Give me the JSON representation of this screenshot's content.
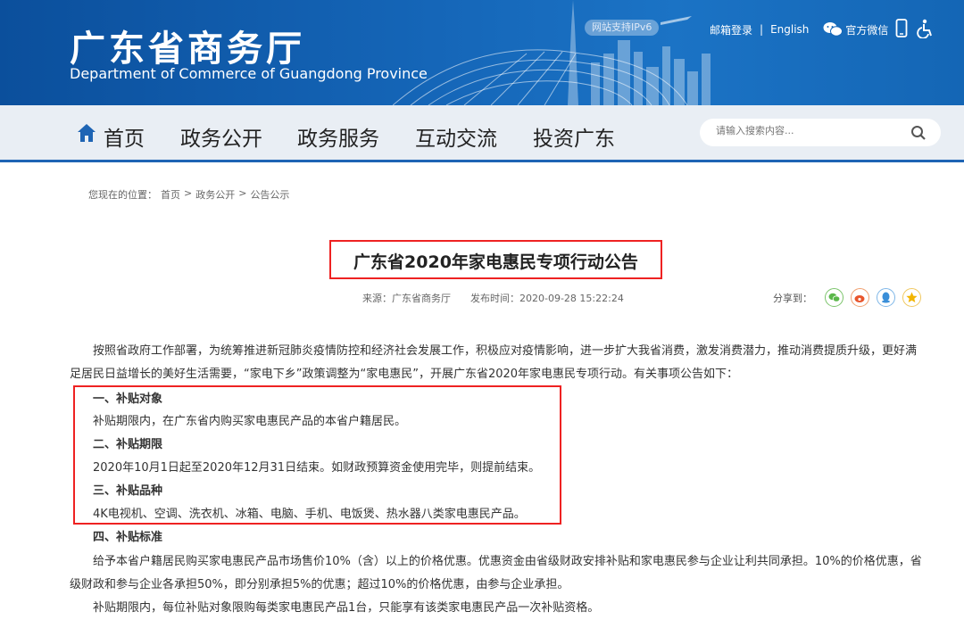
{
  "header": {
    "title_cn": "广东省商务厅",
    "title_en": "Department of Commerce of Guangdong Province",
    "ipv6_badge": "网站支持IPv6",
    "mail_login": "邮箱登录",
    "separator": "|",
    "english": "English",
    "wechat": "官方微信"
  },
  "nav": {
    "items": [
      "首页",
      "政务公开",
      "政务服务",
      "互动交流",
      "投资广东"
    ],
    "search_placeholder": "请输入搜索内容..."
  },
  "breadcrumb": {
    "prefix": "您现在的位置：",
    "items": [
      "首页",
      "政务公开",
      "公告公示"
    ],
    "sep": ">"
  },
  "article": {
    "title": "广东省2020年家电惠民专项行动公告",
    "source": "来源：广东省商务厅",
    "publish_time": "发布时间：2020-09-28 15:22:24",
    "share_label": "分享到：",
    "intro_1": "按照省政府工作部署，为统筹推进新冠肺炎疫情防控和经济社会发展工作，积极应对疫情影响，进一步扩大我省消费，激发消费潜力，推动消费提质升级，更好满",
    "intro_2": "足居民日益增长的美好生活需要，“家电下乡”政策调整为“家电惠民”，开展广东省2020年家电惠民专项行动。有关事项公告如下：",
    "s1_title": "一、补贴对象",
    "s1_text": "补贴期限内，在广东省内购买家电惠民产品的本省户籍居民。",
    "s2_title": "二、补贴期限",
    "s2_text": "2020年10月1日起至2020年12月31日结束。如财政预算资金使用完毕，则提前结束。",
    "s3_title": "三、补贴品种",
    "s3_text": "4K电视机、空调、洗衣机、冰箱、电脑、手机、电饭煲、热水器八类家电惠民产品。",
    "s4_title": "四、补贴标准",
    "s4_text_1": "给予本省户籍居民购买家电惠民产品市场售价10%（含）以上的价格优惠。优惠资金由省级财政安排补贴和家电惠民参与企业让利共同承担。10%的价格优惠，省",
    "s4_text_2": "级财政和参与企业各承担50%，即分别承担5%的优惠；超过10%的价格优惠，由参与企业承担。",
    "s4_text_3": "补贴期限内，每位补贴对象限购每类家电惠民产品1台，只能享有该类家电惠民产品一次补贴资格。"
  },
  "colors": {
    "header_blue": "#1566b8",
    "nav_bg": "#e9eef4",
    "highlight_red": "#e22222"
  }
}
